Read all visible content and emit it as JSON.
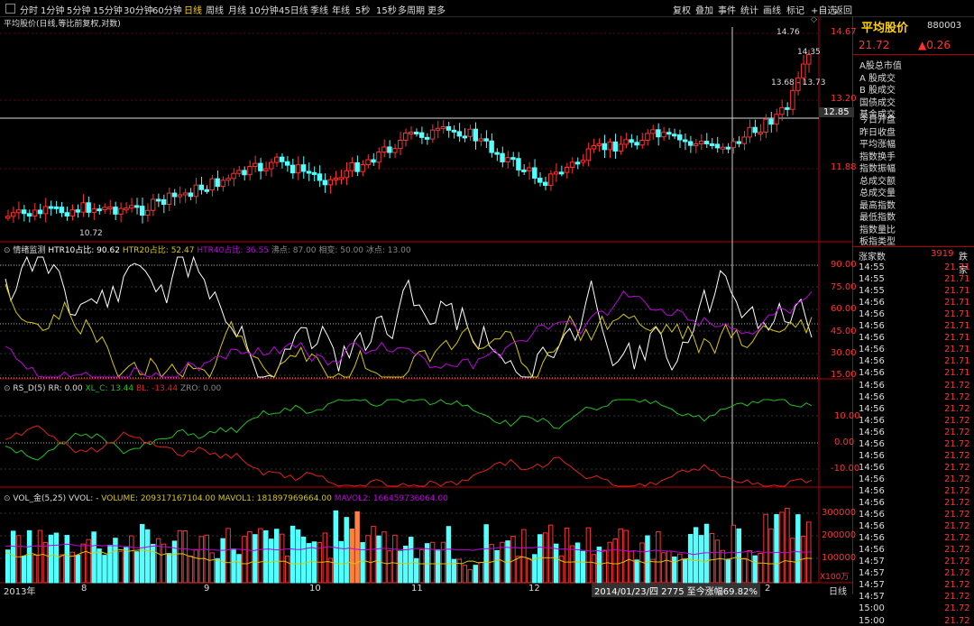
{
  "toolbar": {
    "left": [
      "分时",
      "1分钟",
      "5分钟",
      "15分钟",
      "30分钟",
      "60分钟",
      "日线",
      "周线",
      "月线",
      "10分钟",
      "45日线",
      "季线",
      "年线",
      "5秒",
      "15秒",
      "多周期",
      "更多"
    ],
    "active_index": 6,
    "right": [
      "复权",
      "叠加",
      "事件",
      "统计",
      "画线",
      "标记",
      "+自选",
      "返回"
    ]
  },
  "chart_title": "平均股价(日线,等比前复权,对数)",
  "price_axis": [
    "14.67",
    "13.20",
    "11.88"
  ],
  "price_marker": "12.85",
  "price_annotations": {
    "high": "14.76",
    "low": "14.35",
    "range": "13.68 - 13.73",
    "min": "10.72"
  },
  "htr": {
    "title": "情绪监测",
    "htr10": "HTR10占比: 90.62",
    "htr20": "HTR20占比: 52.47",
    "htr40": "HTR40占比: 36.55",
    "rest": "沸点: 87.00  相变: 50.00  冰点: 13.00",
    "axis": [
      "90.00",
      "75.00",
      "60.00",
      "45.00",
      "30.00",
      "15.00"
    ]
  },
  "rsd": {
    "title": "RS_D(5)",
    "rr": "RR: 0.00",
    "xlc": "XL_C: 13.44",
    "bl": "BL: -13.44",
    "zro": "ZRO: 0.00",
    "axis": [
      "10.00",
      "0.00",
      "-10.00"
    ]
  },
  "vol": {
    "title": "VOL_金(5,25)",
    "vvol": "VVOL: -",
    "volume": "VOLUME: 209317167104.00",
    "mavol1": "MAVOL1: 181897969664.00",
    "mavol2": "MAVOL2: 166459736064.00",
    "axis": [
      "300000",
      "200000",
      "100000"
    ],
    "unit": "X100万"
  },
  "date_axis": {
    "labels": [
      "2013年",
      "8",
      "9",
      "10",
      "11",
      "12",
      "2014/01/23/四 2775 至今涨幅69.82%",
      "2"
    ],
    "period": "日线"
  },
  "quote": {
    "name": "平均股价",
    "code": "880003",
    "price": "21.72",
    "change": "▲0.26"
  },
  "panel_items": [
    "A股总市值",
    "A 股成交",
    "B 股成交",
    "国债成交",
    "基金成交",
    "今日开盘",
    "昨日收盘",
    "平均涨幅",
    "指数换手",
    "指数振幅",
    "总成交额",
    "总成交量",
    "最高指数",
    "最低指数",
    "指数量比",
    "板指类型"
  ],
  "stats": {
    "label": "涨家数",
    "value": "3919",
    "extra": "跌家"
  },
  "ticks": [
    {
      "t": "14:55",
      "p": "21.71"
    },
    {
      "t": "14:55",
      "p": "21.71"
    },
    {
      "t": "14:55",
      "p": "21.71"
    },
    {
      "t": "14:56",
      "p": "21.71"
    },
    {
      "t": "14:56",
      "p": "21.71"
    },
    {
      "t": "14:56",
      "p": "21.71"
    },
    {
      "t": "14:56",
      "p": "21.71"
    },
    {
      "t": "14:56",
      "p": "21.71"
    },
    {
      "t": "14:56",
      "p": "21.71"
    },
    {
      "t": "14:56",
      "p": "21.71"
    },
    {
      "t": "14:56",
      "p": "21.72"
    },
    {
      "t": "14:56",
      "p": "21.72"
    },
    {
      "t": "14:56",
      "p": "21.72"
    },
    {
      "t": "14:56",
      "p": "21.72"
    },
    {
      "t": "14:56",
      "p": "21.72"
    },
    {
      "t": "14:56",
      "p": "21.72"
    },
    {
      "t": "14:56",
      "p": "21.72"
    },
    {
      "t": "14:56",
      "p": "21.72"
    },
    {
      "t": "14:56",
      "p": "21.72"
    },
    {
      "t": "14:56",
      "p": "21.72"
    },
    {
      "t": "14:56",
      "p": "21.72"
    },
    {
      "t": "14:56",
      "p": "21.72"
    },
    {
      "t": "14:56",
      "p": "21.72"
    },
    {
      "t": "14:56",
      "p": "21.72"
    },
    {
      "t": "14:56",
      "p": "21.72"
    },
    {
      "t": "14:57",
      "p": "21.72"
    },
    {
      "t": "14:57",
      "p": "21.72"
    },
    {
      "t": "14:57",
      "p": "21.72"
    },
    {
      "t": "14:57",
      "p": "21.72"
    },
    {
      "t": "15:00",
      "p": "21.72"
    },
    {
      "t": "15:00",
      "p": "21.72"
    }
  ],
  "colors": {
    "up": "#ff3232",
    "down": "#54ffff",
    "htr10": "#ffffff",
    "htr20": "#d7c800",
    "htr40": "#c000e0",
    "xl": "#22c022",
    "bl": "#e02020",
    "accent": "#ffd200"
  }
}
